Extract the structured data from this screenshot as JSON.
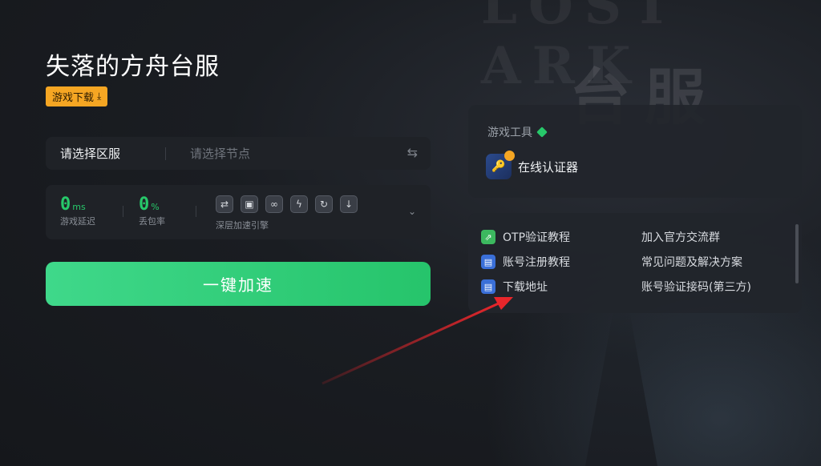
{
  "background": {
    "logo_text": "LOST ARK",
    "server_text": "台服"
  },
  "game": {
    "title": "失落的方舟台服",
    "download_label": "游戏下载"
  },
  "selector": {
    "region": "请选择区服",
    "node": "请选择节点"
  },
  "stats": {
    "latency_value": "0",
    "latency_unit": "ms",
    "latency_label": "游戏延迟",
    "loss_value": "0",
    "loss_unit": "%",
    "loss_label": "丢包率",
    "engine_label": "深层加速引擎",
    "engine_icons": [
      "link-icon",
      "screen-icon",
      "chain-icon",
      "bolt-icon",
      "refresh-icon",
      "download-icon"
    ]
  },
  "accelerate_label": "一键加速",
  "tools": {
    "title": "游戏工具",
    "items": [
      {
        "label": "在线认证器",
        "icon": "authenticator-icon"
      }
    ]
  },
  "links": {
    "left": [
      {
        "label": "OTP验证教程",
        "icon": "link-icon",
        "color": "#3cb85f"
      },
      {
        "label": "账号注册教程",
        "icon": "tutorial-icon",
        "color": "#3a6fd8"
      },
      {
        "label": "下载地址",
        "icon": "tutorial-icon",
        "color": "#3a6fd8"
      }
    ],
    "right": [
      {
        "label": "加入官方交流群"
      },
      {
        "label": "常见问题及解决方案"
      },
      {
        "label": "账号验证接码(第三方)"
      }
    ]
  },
  "colors": {
    "accent_green": "#27c86a",
    "download_orange": "#f5a623",
    "annotation_red": "#e8262b"
  }
}
